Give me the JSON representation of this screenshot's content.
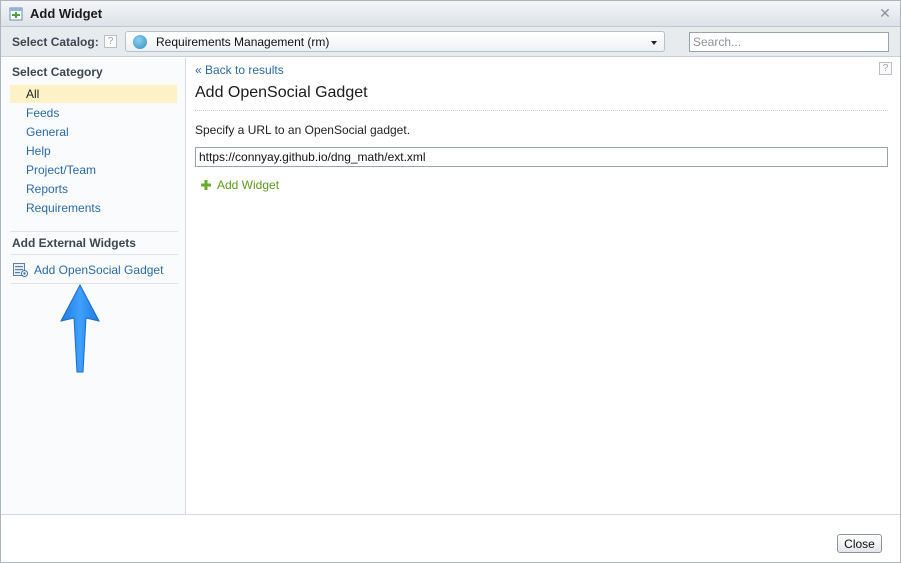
{
  "dialog": {
    "title": "Add Widget",
    "close_glyph": "✕"
  },
  "catalog": {
    "label": "Select Catalog:",
    "help_glyph": "?",
    "selected": "Requirements Management (rm)",
    "icon": "requirements-management-icon"
  },
  "search": {
    "placeholder": "Search..."
  },
  "sidebar": {
    "category_heading": "Select Category",
    "categories": [
      {
        "label": "All",
        "selected": true
      },
      {
        "label": "Feeds"
      },
      {
        "label": "General"
      },
      {
        "label": "Help"
      },
      {
        "label": "Project/Team"
      },
      {
        "label": "Reports"
      },
      {
        "label": "Requirements"
      }
    ],
    "external_heading": "Add External Widgets",
    "external_link": "Add OpenSocial Gadget",
    "external_icon": "opensocial-gadget-icon"
  },
  "annotation": {
    "arrow_color": "#2e8cf0"
  },
  "main": {
    "back_link": "« Back to results",
    "help_glyph": "?",
    "title": "Add OpenSocial Gadget",
    "instructions": "Specify a URL to an OpenSocial gadget.",
    "url_value": "https://connyay.github.io/dng_math/ext.xml",
    "add_widget_label": "Add Widget"
  },
  "footer": {
    "close_label": "Close"
  },
  "colors": {
    "link": "#2b6aa6",
    "add_widget": "#5c9a1e",
    "selected_category_bg": "#fdf1c7"
  }
}
